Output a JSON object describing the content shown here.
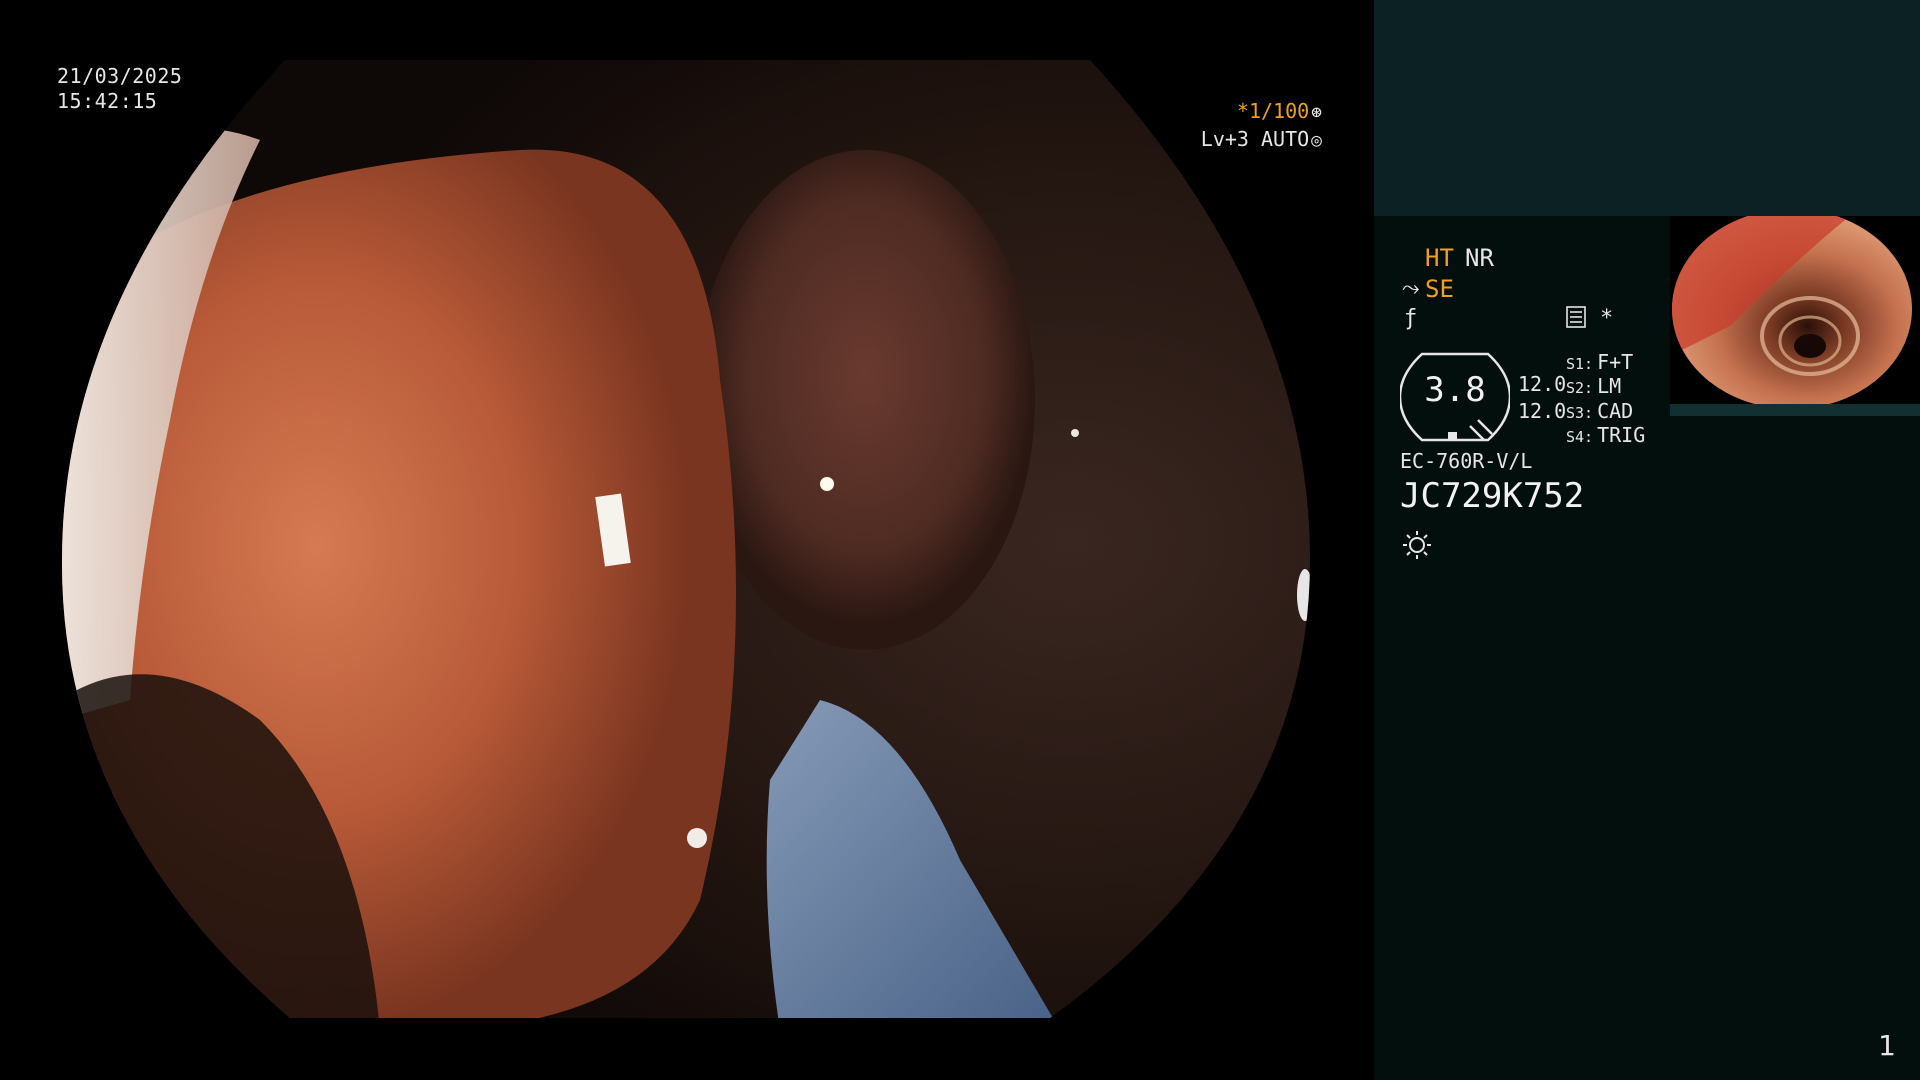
{
  "overlay": {
    "date": "21/03/2025",
    "time": "15:42:15",
    "shutter": "*1/100",
    "level": "Lv+3 AUTO"
  },
  "panel": {
    "ht": "HT",
    "nr": "NR",
    "se": "SE",
    "star": "*",
    "gauge_value": "3.8",
    "value_1": "12.0",
    "value_2": "12.0",
    "scope_keys": [
      {
        "key": "S1:",
        "value": "F+T"
      },
      {
        "key": "S2:",
        "value": "LM"
      },
      {
        "key": "S3:",
        "value": "CAD"
      },
      {
        "key": "S4:",
        "value": "TRIG"
      }
    ],
    "model": "EC-760R-V/L",
    "serial": "JC729K752",
    "page_number": "1"
  },
  "colors": {
    "accent_orange": "#f0a020",
    "panel_top": "#0b2124",
    "panel_bg": "#030f0d",
    "text": "#e6e6e6"
  },
  "icons": [
    "shutter-dial-icon",
    "auto-dial-icon",
    "se-scope-icon",
    "f-curve-icon",
    "menu-list-icon",
    "light-source-icon"
  ]
}
